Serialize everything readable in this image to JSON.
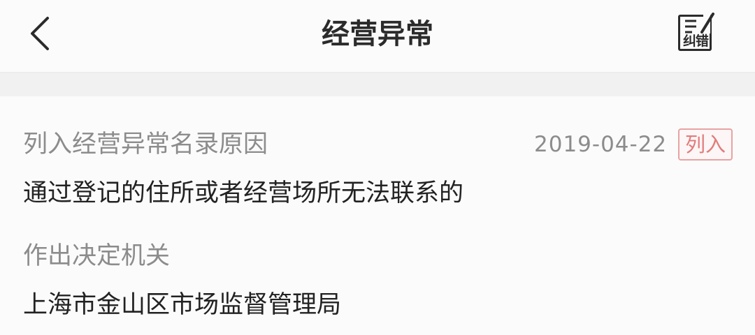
{
  "header": {
    "title": "经营异常",
    "report_label": "纠错"
  },
  "record": {
    "reason_label": "列入经营异常名录原因",
    "date": "2019-04-22",
    "status_tag": "列入",
    "reason": "通过登记的住所或者经营场所无法联系的",
    "authority_label": "作出决定机关",
    "authority": "上海市金山区市场监督管理局"
  },
  "icons": {
    "back": "chevron-left-icon",
    "report": "report-error-icon"
  },
  "colors": {
    "tag_border": "#e8a3a3",
    "tag_text": "#e07c7c"
  }
}
